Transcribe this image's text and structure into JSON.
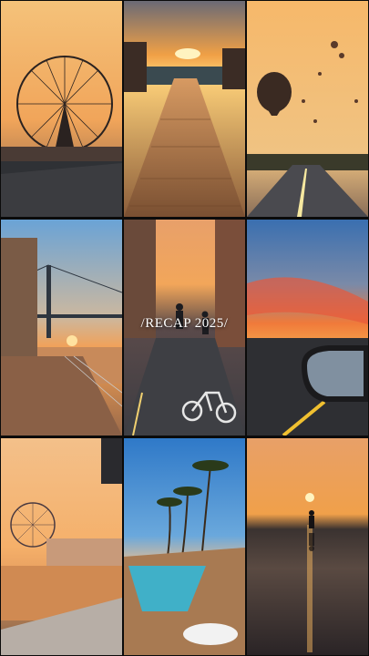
{
  "overlay": {
    "caption": "/RECAP 2025/"
  },
  "tiles": [
    {
      "icon": "ferris-wheel-sunset"
    },
    {
      "icon": "boardwalk-sunset"
    },
    {
      "icon": "hot-air-balloons-road"
    },
    {
      "icon": "bridge-waterfront"
    },
    {
      "icon": "cyclists-street"
    },
    {
      "icon": "car-mirror-sunset"
    },
    {
      "icon": "london-eye-river"
    },
    {
      "icon": "palm-pool-resort"
    },
    {
      "icon": "beach-silhouette"
    }
  ],
  "colors": {
    "sunset_orange": "#f0903a",
    "sky_blue": "#2f79c8",
    "gutter": "#0b0b0b"
  }
}
